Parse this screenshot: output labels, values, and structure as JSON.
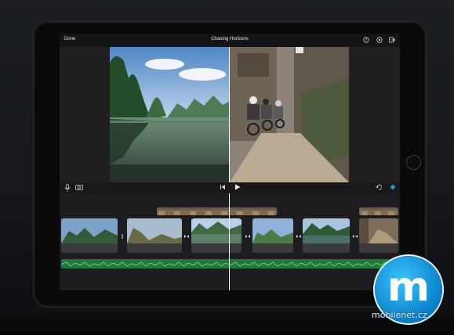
{
  "topbar": {
    "done_label": "Done",
    "project_title": "Chasing Horizons",
    "icons": [
      "help-icon",
      "settings-icon",
      "share-icon"
    ]
  },
  "watermark": {
    "letter": "m",
    "text": "mobilenet.cz"
  },
  "colors": {
    "audio_track": "#1f7a3a",
    "accent": "#2f8fd6",
    "screen_bg": "#1a1a1c"
  }
}
